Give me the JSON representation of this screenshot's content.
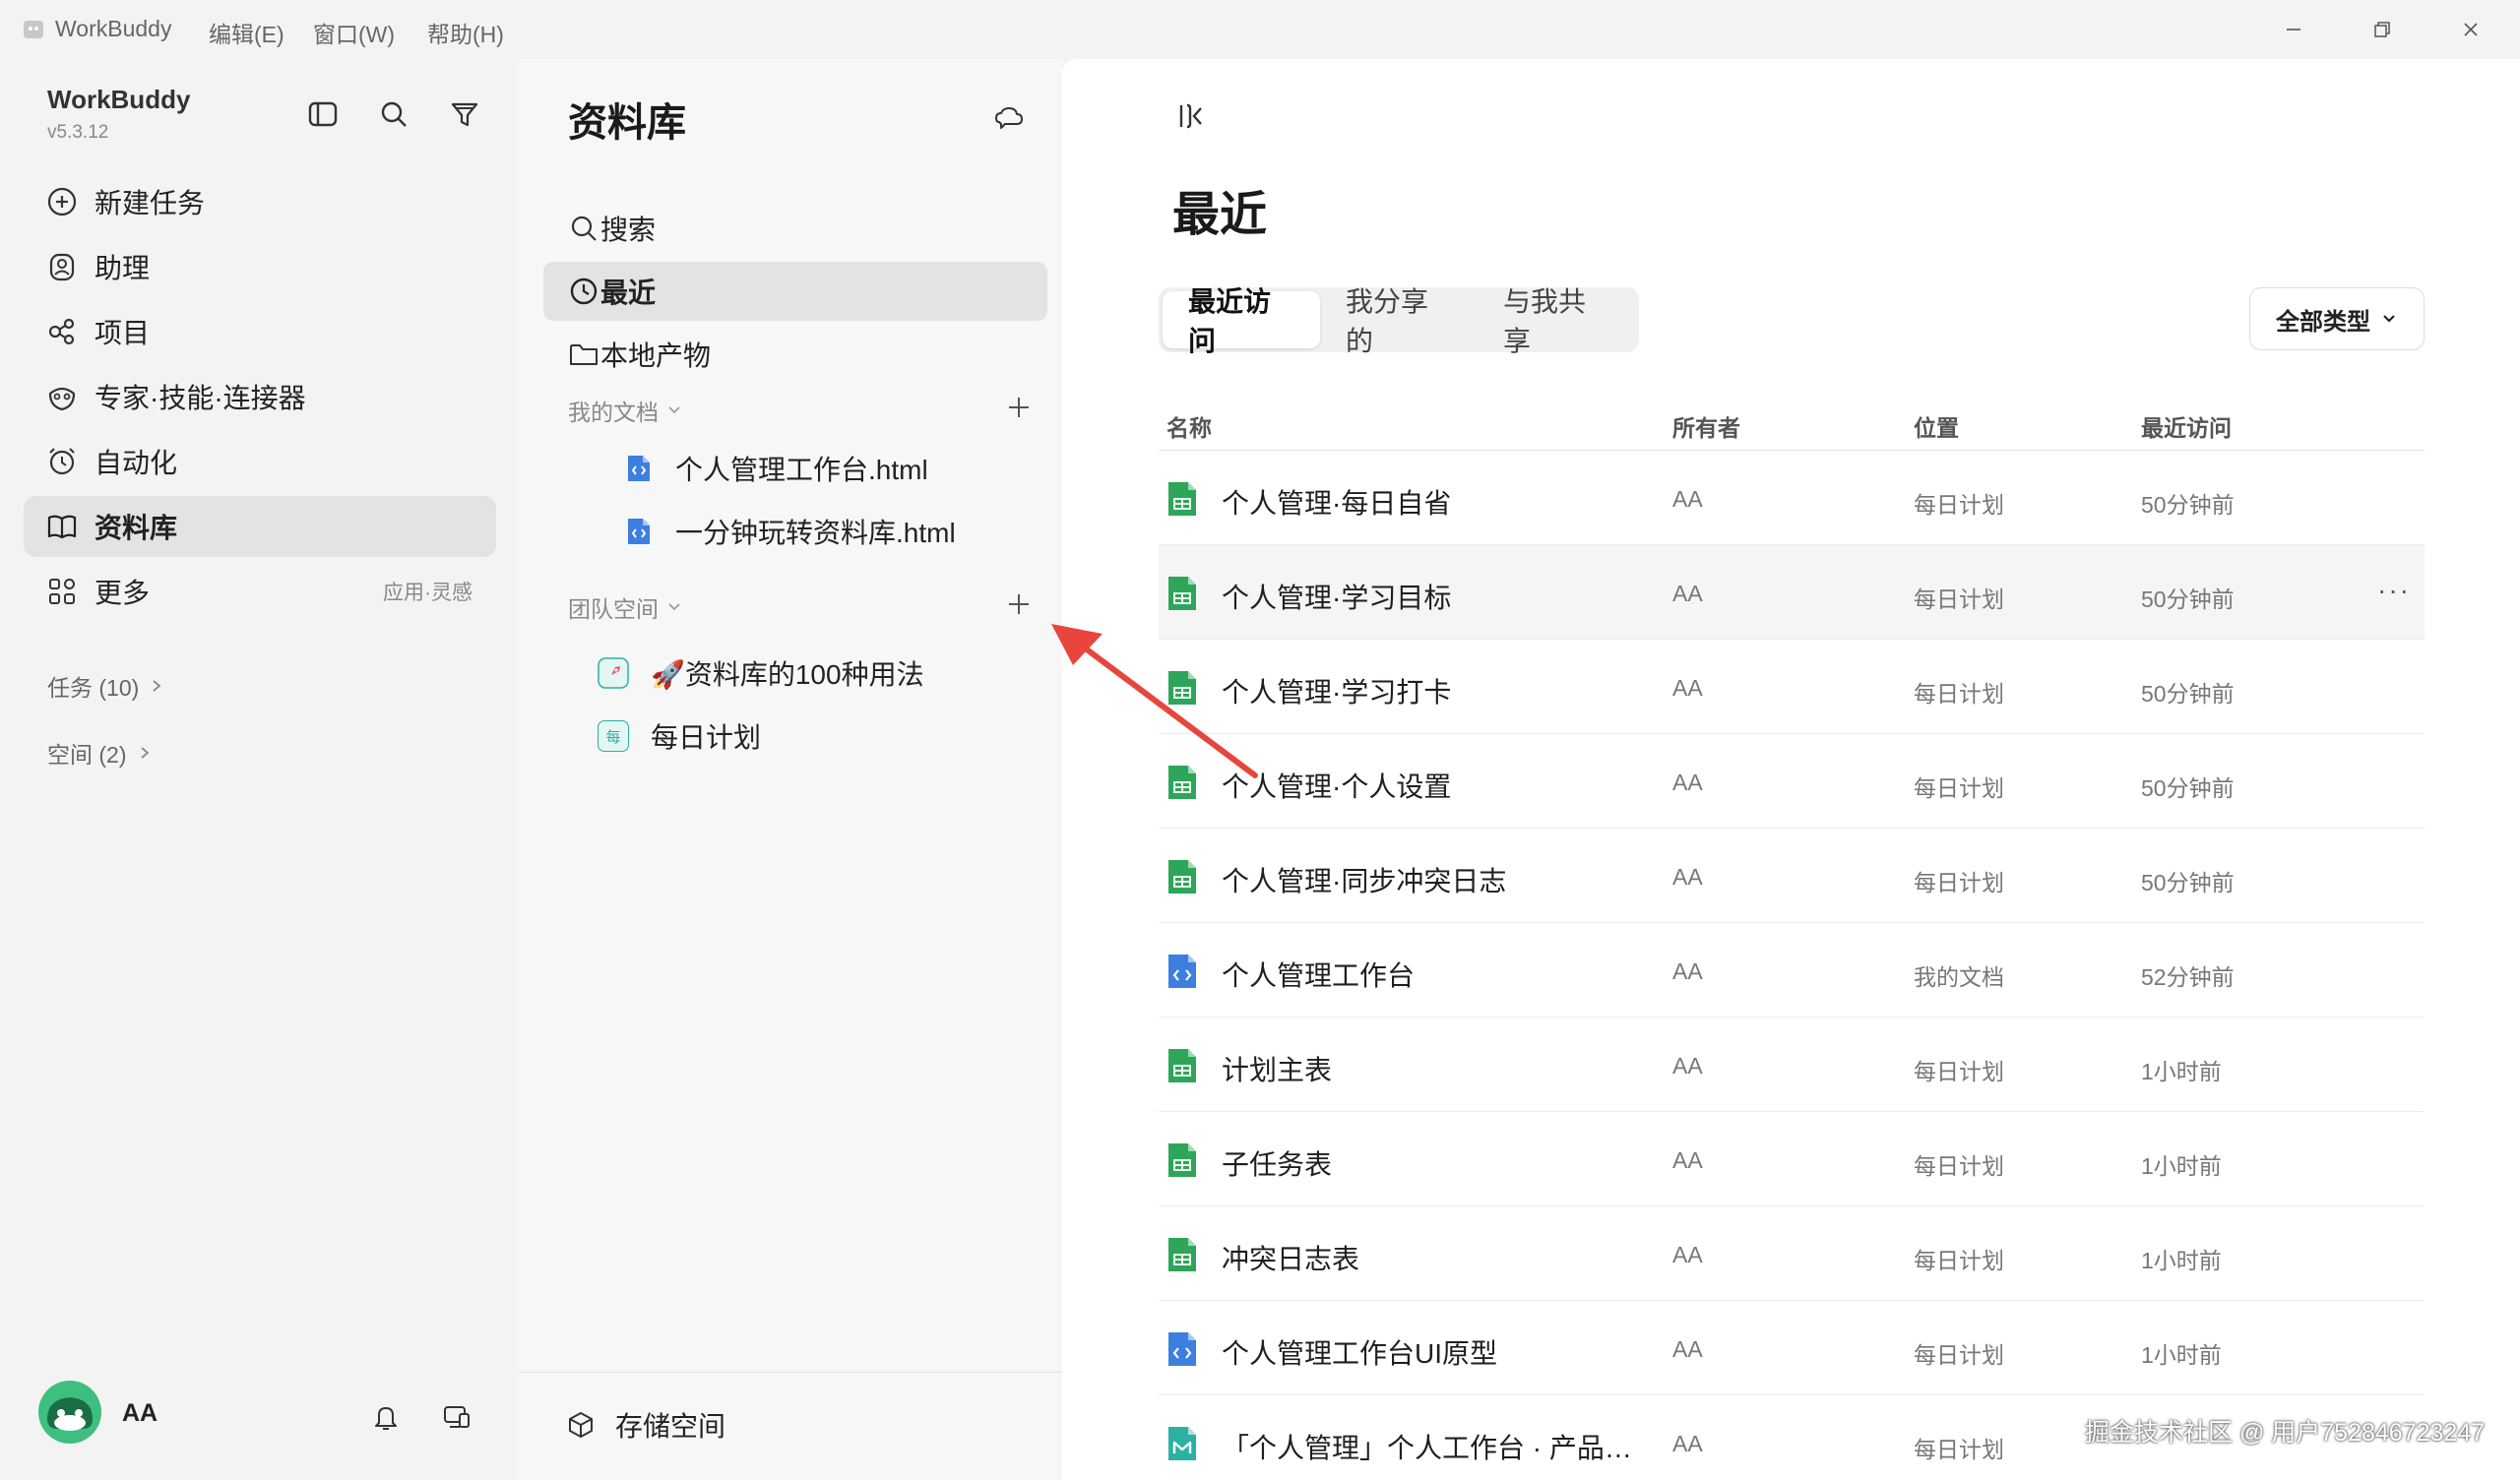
{
  "titlebar": {
    "app_name": "WorkBuddy",
    "menus": [
      "编辑(E)",
      "窗口(W)",
      "帮助(H)"
    ]
  },
  "sidebar": {
    "title": "WorkBuddy",
    "version": "v5.3.12",
    "items": [
      {
        "label": "新建任务",
        "icon": "plus-circle-icon"
      },
      {
        "label": "助理",
        "icon": "assistant-icon"
      },
      {
        "label": "项目",
        "icon": "project-icon"
      },
      {
        "label": "专家·技能·连接器",
        "icon": "expert-icon"
      },
      {
        "label": "自动化",
        "icon": "alarm-clock-icon"
      },
      {
        "label": "资料库",
        "icon": "book-icon",
        "active": true
      },
      {
        "label": "更多",
        "icon": "grid-icon",
        "hint": "应用·灵感"
      }
    ],
    "groups": [
      {
        "label": "任务 (10)"
      },
      {
        "label": "空间 (2)"
      }
    ],
    "user": {
      "name": "AA"
    }
  },
  "panel": {
    "title": "资料库",
    "items": [
      {
        "label": "搜索",
        "icon": "search-icon"
      },
      {
        "label": "最近",
        "icon": "clock-icon",
        "active": true
      },
      {
        "label": "本地产物",
        "icon": "folder-icon"
      }
    ],
    "my_docs": {
      "label": "我的文档",
      "docs": [
        "个人管理工作台.html",
        "一分钟玩转资料库.html"
      ]
    },
    "team_space": {
      "label": "团队空间",
      "spaces": [
        {
          "label": "🚀资料库的100种用法",
          "icon": "rocket-icon"
        },
        {
          "label": "每日计划",
          "badge": "每"
        }
      ]
    },
    "storage": "存储空间"
  },
  "main": {
    "title": "最近",
    "tabs": [
      "最近访问",
      "我分享的",
      "与我共享"
    ],
    "active_tab": 0,
    "filter": "全部类型",
    "columns": [
      "名称",
      "所有者",
      "位置",
      "最近访问"
    ],
    "rows": [
      {
        "name": "个人管理·每日自省",
        "owner": "AA",
        "location": "每日计划",
        "time": "50分钟前",
        "type": "sheet"
      },
      {
        "name": "个人管理·学习目标",
        "owner": "AA",
        "location": "每日计划",
        "time": "50分钟前",
        "type": "sheet",
        "hover": true
      },
      {
        "name": "个人管理·学习打卡",
        "owner": "AA",
        "location": "每日计划",
        "time": "50分钟前",
        "type": "sheet"
      },
      {
        "name": "个人管理·个人设置",
        "owner": "AA",
        "location": "每日计划",
        "time": "50分钟前",
        "type": "sheet"
      },
      {
        "name": "个人管理·同步冲突日志",
        "owner": "AA",
        "location": "每日计划",
        "time": "50分钟前",
        "type": "sheet"
      },
      {
        "name": "个人管理工作台",
        "owner": "AA",
        "location": "我的文档",
        "time": "52分钟前",
        "type": "code"
      },
      {
        "name": "计划主表",
        "owner": "AA",
        "location": "每日计划",
        "time": "1小时前",
        "type": "sheet"
      },
      {
        "name": "子任务表",
        "owner": "AA",
        "location": "每日计划",
        "time": "1小时前",
        "type": "sheet"
      },
      {
        "name": "冲突日志表",
        "owner": "AA",
        "location": "每日计划",
        "time": "1小时前",
        "type": "sheet"
      },
      {
        "name": "个人管理工作台UI原型",
        "owner": "AA",
        "location": "每日计划",
        "time": "1小时前",
        "type": "code"
      },
      {
        "name": "「个人管理」个人工作台 · 产品说...",
        "owner": "AA",
        "location": "每日计划",
        "time": "",
        "type": "markdown"
      }
    ],
    "row_more": "···"
  },
  "watermark": "掘金技术社区 @ 用户752846723247",
  "colors": {
    "sheet": "#2ea65a",
    "code": "#3d7fe0",
    "markdown": "#2bb0a4",
    "arrow": "#e8453c"
  }
}
